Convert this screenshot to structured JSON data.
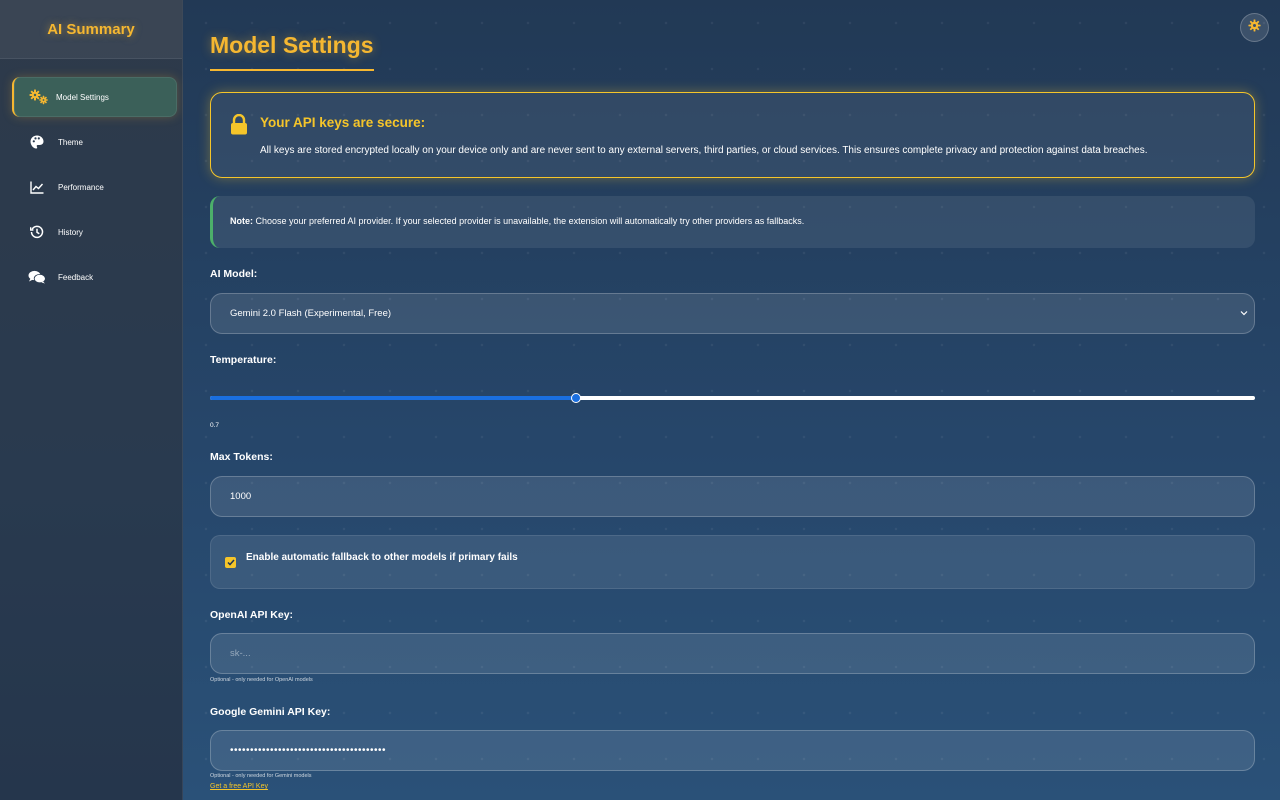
{
  "app": {
    "title": "AI Summary"
  },
  "sidebar": {
    "items": [
      {
        "label": "Model Settings",
        "icon": "gears-icon",
        "active": true
      },
      {
        "label": "Theme",
        "icon": "palette-icon"
      },
      {
        "label": "Performance",
        "icon": "chart-line-icon"
      },
      {
        "label": "History",
        "icon": "history-icon"
      },
      {
        "label": "Feedback",
        "icon": "comments-icon"
      }
    ]
  },
  "header": {
    "settings_icon": "gear-icon"
  },
  "page": {
    "title": "Model Settings"
  },
  "security": {
    "icon": "lock-icon",
    "heading": "Your API keys are secure:",
    "body": "All keys are stored encrypted locally on your device only and are never sent to any external servers, third parties, or cloud services. This ensures complete privacy and protection against data breaches."
  },
  "note": {
    "bold": "Note:",
    "text": " Choose your preferred AI provider. If your selected provider is unavailable, the extension will automatically try other providers as fallbacks."
  },
  "model": {
    "label": "AI Model:",
    "selected": "Gemini 2.0 Flash (Experimental, Free)"
  },
  "temperature": {
    "label": "Temperature:",
    "value": 0.7,
    "min": 0,
    "max": 2,
    "display": "0.7"
  },
  "max_tokens": {
    "label": "Max Tokens:",
    "value": "1000"
  },
  "fallback": {
    "label": "Enable automatic fallback to other models if primary fails",
    "checked": true
  },
  "openai": {
    "label": "OpenAI API Key:",
    "placeholder": "sk-...",
    "hint": "Optional - only needed for OpenAI models"
  },
  "gemini": {
    "label": "Google Gemini API Key:",
    "value_masked": "•••••••••••••••••••••••••••••••••••••••",
    "hint": "Optional - only needed for Gemini models",
    "link": "Get a free API Key"
  },
  "colors": {
    "accent": "#f5b731",
    "active_nav": "#3b6059",
    "slider_fill": "#1a6fe0",
    "note_border": "#4caf6a"
  }
}
